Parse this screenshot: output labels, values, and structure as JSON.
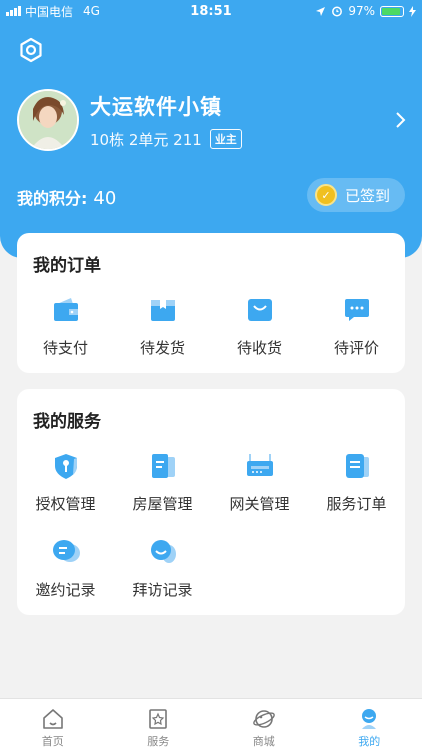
{
  "status_bar": {
    "carrier": "中国电信",
    "network": "4G",
    "time": "18:51",
    "battery": "97%"
  },
  "profile": {
    "name": "大运软件小镇",
    "address": "10栋 2单元 211",
    "role_badge": "业主"
  },
  "points": {
    "label": "我的积分:",
    "value": "40",
    "signin_label": "已签到"
  },
  "orders": {
    "title": "我的订单",
    "items": [
      {
        "label": "待支付",
        "icon": "wallet-icon"
      },
      {
        "label": "待发货",
        "icon": "package-icon"
      },
      {
        "label": "待收货",
        "icon": "shopping-bag-icon"
      },
      {
        "label": "待评价",
        "icon": "comment-icon"
      }
    ]
  },
  "services": {
    "title": "我的服务",
    "items": [
      {
        "label": "授权管理",
        "icon": "shield-key-icon"
      },
      {
        "label": "房屋管理",
        "icon": "house-doc-icon"
      },
      {
        "label": "网关管理",
        "icon": "router-icon"
      },
      {
        "label": "服务订单",
        "icon": "order-list-icon"
      },
      {
        "label": "邀约记录",
        "icon": "invite-chat-icon"
      },
      {
        "label": "拜访记录",
        "icon": "visit-person-icon"
      }
    ]
  },
  "tabbar": {
    "items": [
      {
        "label": "首页",
        "icon": "home-icon"
      },
      {
        "label": "服务",
        "icon": "service-star-icon"
      },
      {
        "label": "商城",
        "icon": "mall-planet-icon"
      },
      {
        "label": "我的",
        "icon": "profile-icon",
        "active": true
      }
    ]
  },
  "colors": {
    "primary": "#3da8f0",
    "icon_blue": "#3da8f0",
    "icon_light": "#9fd2f7",
    "background": "#f2f2f2"
  }
}
